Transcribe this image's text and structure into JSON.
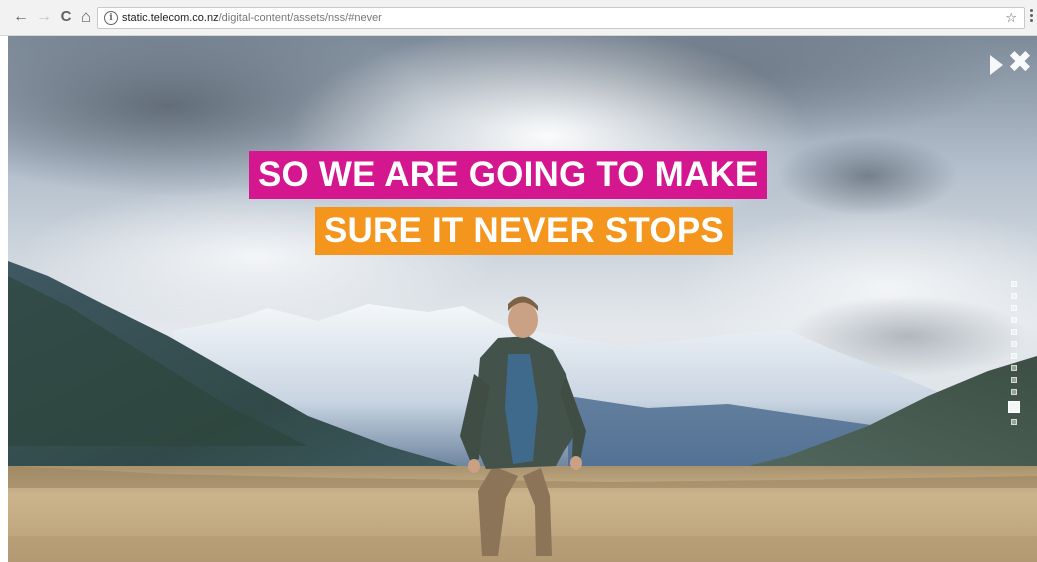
{
  "browser": {
    "back_icon": "arrow-left-icon",
    "back_glyph": "←",
    "forward_icon": "arrow-right-icon",
    "forward_glyph": "→",
    "reload_icon": "reload-icon",
    "reload_glyph": "C",
    "home_icon": "home-icon",
    "home_glyph": "⌂",
    "info_icon": "info-icon",
    "info_glyph": "i",
    "url_domain": "static.telecom.co.nz",
    "url_path": "/digital-content/assets/nss/#never",
    "bookmark_icon": "star-icon",
    "bookmark_glyph": "☆",
    "menu_icon": "vertical-dots-icon"
  },
  "hero": {
    "headline_line1": "SO WE ARE GOING TO MAKE",
    "headline_line2": "SURE IT NEVER STOPS",
    "line1_bg": "#d4168f",
    "line2_bg": "#f4951d",
    "play_icon": "play-icon",
    "close_icon": "close-icon",
    "close_glyph": "✖",
    "slide_count": 12,
    "active_slide": 11
  },
  "colors": {
    "sky": "#c6d0da",
    "field": "#c7ad85",
    "magenta": "#d4168f",
    "orange": "#f4951d"
  }
}
